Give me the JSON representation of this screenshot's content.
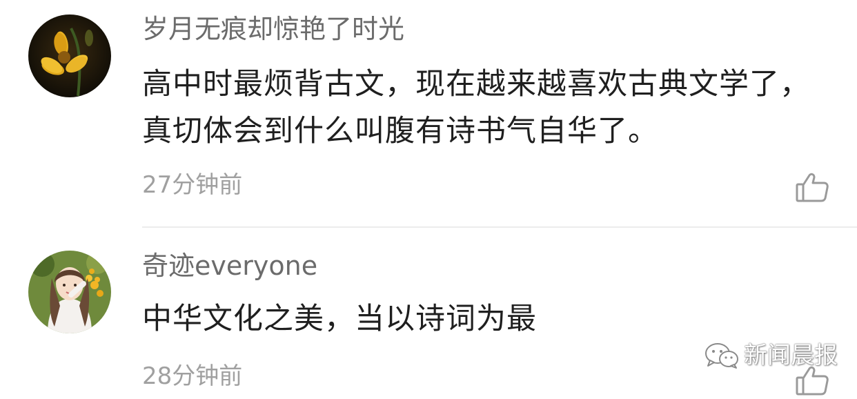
{
  "comments": [
    {
      "username": "岁月无痕却惊艳了时光",
      "text": "高中时最烦背古文，现在越来越喜欢古典文学了，真切体会到什么叫腹有诗书气自华了。",
      "timestamp": "27分钟前",
      "avatar": "yellow-flower-photo",
      "like_icon": "thumbs-up-icon"
    },
    {
      "username": "奇迹everyone",
      "text": "中华文化之美，当以诗词为最",
      "timestamp": "28分钟前",
      "avatar": "girl-with-flowers-photo",
      "like_icon": "thumbs-up-icon"
    }
  ],
  "watermark": {
    "text": "新闻晨报",
    "icon": "wechat-icon"
  },
  "colors": {
    "username": "#6b6b6b",
    "body_text": "#1f1f1f",
    "timestamp": "#a0a0a0",
    "divider": "#ececec",
    "icon_stroke": "#9a9a9a"
  }
}
